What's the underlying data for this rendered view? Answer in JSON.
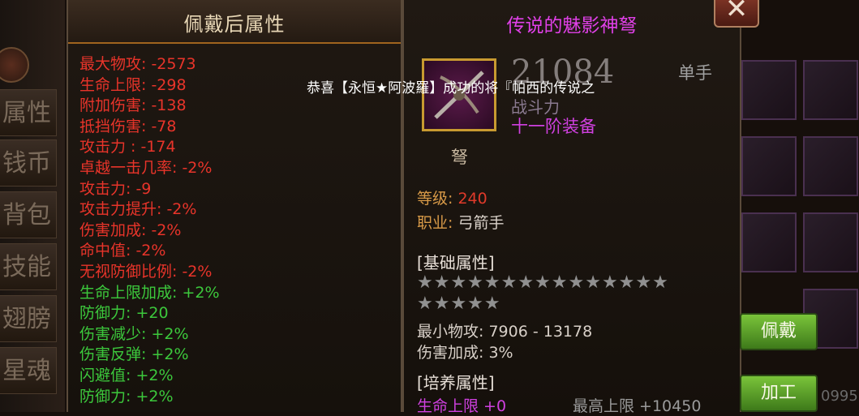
{
  "left_panel": {
    "title": "佩戴后属性",
    "stats": [
      {
        "text": "最大物攻: -2573",
        "color": "#e8342a"
      },
      {
        "text": "生命上限: -298",
        "color": "#e8342a"
      },
      {
        "text": "附加伤害: -138",
        "color": "#e8342a"
      },
      {
        "text": "抵挡伤害: -78",
        "color": "#e8342a"
      },
      {
        "text": "攻击力   : -174",
        "color": "#e8342a"
      },
      {
        "text": "卓越一击几率: -2%",
        "color": "#e8342a"
      },
      {
        "text": "攻击力: -9",
        "color": "#e8342a"
      },
      {
        "text": "攻击力提升: -2%",
        "color": "#e8342a"
      },
      {
        "text": "伤害加成: -2%",
        "color": "#e8342a"
      },
      {
        "text": "命中值: -2%",
        "color": "#e8342a"
      },
      {
        "text": "无视防御比例: -2%",
        "color": "#e8342a"
      },
      {
        "text": "生命上限加成: +2%",
        "color": "#3cc83c"
      },
      {
        "text": "防御力: +20",
        "color": "#3cc83c"
      },
      {
        "text": "伤害减少: +2%",
        "color": "#3cc83c"
      },
      {
        "text": "伤害反弹: +2%",
        "color": "#3cc83c"
      },
      {
        "text": "闪避值: +2%",
        "color": "#3cc83c"
      },
      {
        "text": "防御力: +2%",
        "color": "#3cc83c"
      }
    ]
  },
  "side_tabs": [
    "属性",
    "钱币",
    "背包",
    "技能",
    "翅膀",
    "星魂"
  ],
  "item": {
    "name": "传说的魅影神弩",
    "power": "21084",
    "power_label": "战斗力",
    "grade": "十一阶装备",
    "hand": "单手",
    "type": "弩",
    "level_label": "等级: ",
    "level_value": "240",
    "class_label": "职业: ",
    "class_value": "弓箭手",
    "base_section": "[基础属性]",
    "stars_row1": "★★★★★★★★★★★★★★★",
    "stars_row2": "★★★★★",
    "min_attack": "最小物攻: 7906 - 13178",
    "damage_bonus": "伤害加成: 3%",
    "train_section": "[培养属性]",
    "hp_train": "生命上限 +0",
    "max_limit": "最高上限 +10450"
  },
  "buttons": {
    "equip": "佩戴",
    "process": "加工",
    "close": "✕"
  },
  "notice": "恭喜【永恒★阿波羅】成功的将『帕西的传说之",
  "corner_number": "0995"
}
